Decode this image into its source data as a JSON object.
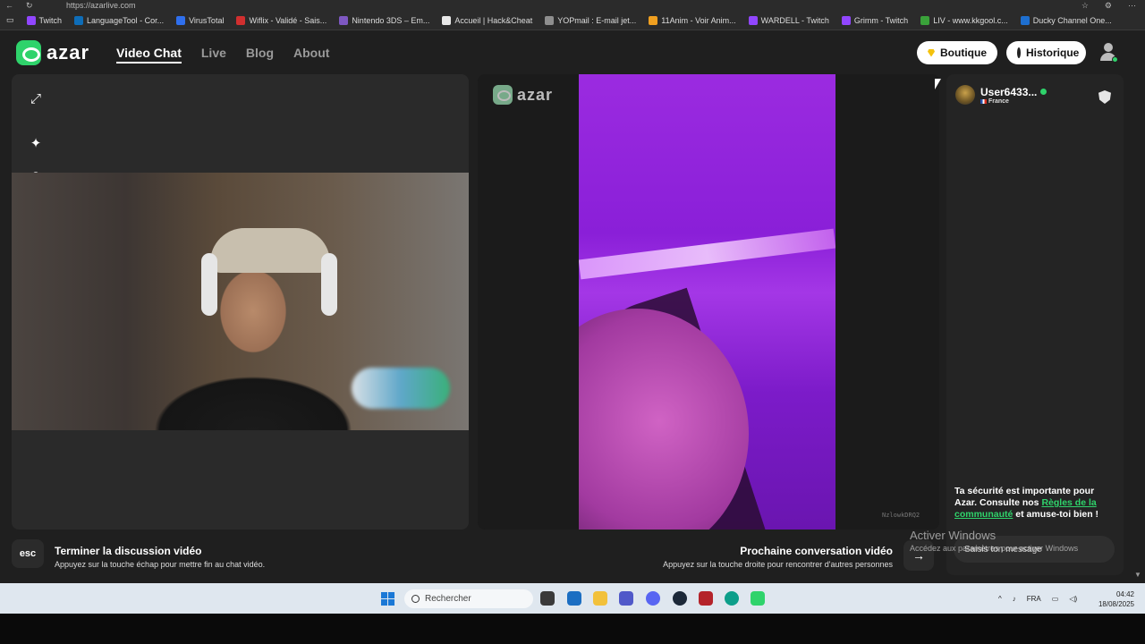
{
  "browser": {
    "url": "https://azarlive.com",
    "bookmarks": [
      {
        "label": "Twitch",
        "color": "#9146ff"
      },
      {
        "label": "LanguageTool - Cor...",
        "color": "#0e6db8"
      },
      {
        "label": "VirusTotal",
        "color": "#2f6fed"
      },
      {
        "label": "Wiflix - Validé - Sais...",
        "color": "#d12f2f"
      },
      {
        "label": "Nintendo 3DS – Em...",
        "color": "#7e58c2"
      },
      {
        "label": "Accueil | Hack&Cheat",
        "color": "#e8e8e8"
      },
      {
        "label": "YOPmail : E-mail jet...",
        "color": "#8e8e8e"
      },
      {
        "label": "11Anim - Voir Anim...",
        "color": "#f0a020"
      },
      {
        "label": "WARDELL - Twitch",
        "color": "#9146ff"
      },
      {
        "label": "Grimm - Twitch",
        "color": "#9146ff"
      },
      {
        "label": "LIV - www.kkgool.c...",
        "color": "#3aa23a"
      },
      {
        "label": "Ducky Channel One...",
        "color": "#1e6fd0"
      }
    ]
  },
  "nav": {
    "logo": "azar",
    "links": [
      "Video Chat",
      "Live",
      "Blog",
      "About"
    ],
    "boutique": "Boutique",
    "historique": "Historique"
  },
  "partner": {
    "logo": "azar",
    "id": "NzlowkDRQ2"
  },
  "chat": {
    "peer_name": "User6433...",
    "peer_country": "France",
    "safety_1": "Ta sécurité est importante pour Azar. Consulte nos ",
    "safety_link": "Règles de la communauté",
    "safety_2": " et amuse-toi bien !",
    "message_placeholder": "Saisis ton message"
  },
  "actions": {
    "esc_label": "esc",
    "end_title": "Terminer la discussion vidéo",
    "end_sub": "Appuyez sur la touche échap pour mettre fin au chat vidéo.",
    "next_title": "Prochaine conversation vidéo",
    "next_sub": "Appuyez sur la touche droite pour rencontrer d'autres personnes"
  },
  "watermark": {
    "title": "Activer Windows",
    "sub": "Accédez aux paramètres pour activer Windows"
  },
  "taskbar": {
    "search_placeholder": "Rechercher",
    "lang": "FRA",
    "time": "04:42",
    "date": "18/08/2025"
  }
}
